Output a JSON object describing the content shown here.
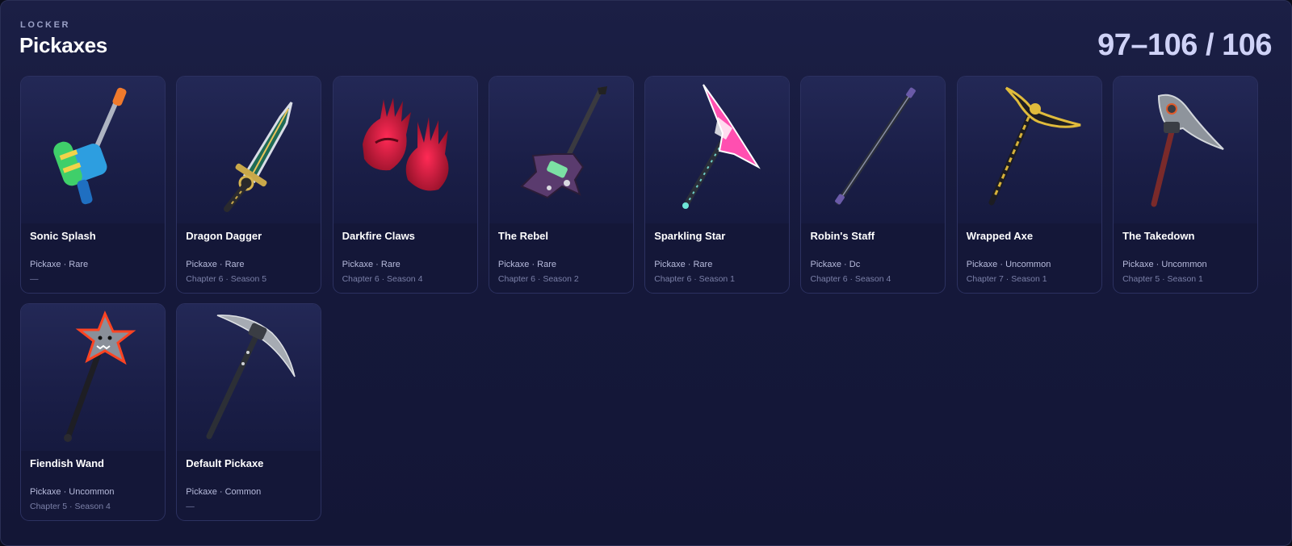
{
  "header": {
    "eyebrow": "LOCKER",
    "title": "Pickaxes",
    "range": "97–106 / 106"
  },
  "items": [
    {
      "name": "Sonic Splash",
      "meta": "Pickaxe · Rare",
      "sub": "—",
      "icon": "water-blaster-icon"
    },
    {
      "name": "Dragon Dagger",
      "meta": "Pickaxe · Rare",
      "sub": "Chapter 6 · Season 5",
      "icon": "dagger-icon"
    },
    {
      "name": "Darkfire Claws",
      "meta": "Pickaxe · Rare",
      "sub": "Chapter 6 · Season 4",
      "icon": "claws-icon"
    },
    {
      "name": "The Rebel",
      "meta": "Pickaxe · Rare",
      "sub": "Chapter 6 · Season 2",
      "icon": "guitar-icon"
    },
    {
      "name": "Sparkling Star",
      "meta": "Pickaxe · Rare",
      "sub": "Chapter 6 · Season 1",
      "icon": "star-axe-icon"
    },
    {
      "name": "Robin's Staff",
      "meta": "Pickaxe · Dc",
      "sub": "Chapter 6 · Season 4",
      "icon": "staff-icon"
    },
    {
      "name": "Wrapped Axe",
      "meta": "Pickaxe · Uncommon",
      "sub": "Chapter 7 · Season 1",
      "icon": "wrapped-axe-icon"
    },
    {
      "name": "The Takedown",
      "meta": "Pickaxe · Uncommon",
      "sub": "Chapter 5 · Season 1",
      "icon": "hatchet-icon"
    },
    {
      "name": "Fiendish Wand",
      "meta": "Pickaxe · Uncommon",
      "sub": "Chapter 5 · Season 4",
      "icon": "star-wand-icon"
    },
    {
      "name": "Default Pickaxe",
      "meta": "Pickaxe · Common",
      "sub": "—",
      "icon": "pickaxe-icon"
    }
  ]
}
